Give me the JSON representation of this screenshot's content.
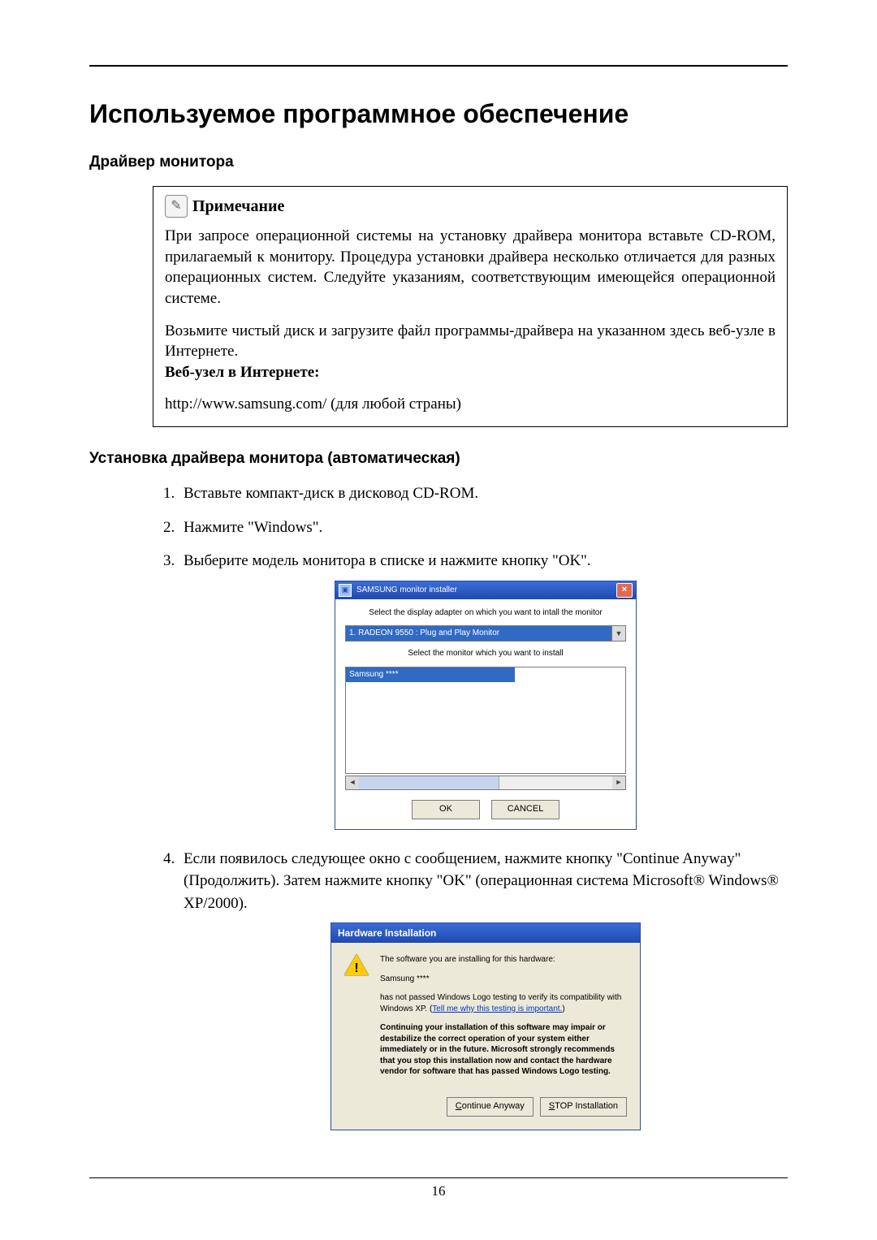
{
  "page_number": "16",
  "h1": "Используемое программное обеспечение",
  "h2_driver": "Драйвер монитора",
  "note": {
    "label": "Примечание",
    "p1": "При запросе операционной системы на установку драйвера монитора вставьте CD-ROM, прилагаемый к монитору. Процедура установки драйвера несколько отличается для разных операционных систем. Следуйте указаниям, соответствующим имеющейся операционной системе.",
    "p2": "Возьмите чистый диск и загрузите файл программы-драйвера на указанном здесь веб-узле в Интернете.",
    "web_label": "Веб-узел в Интернете:",
    "url": "http://www.samsung.com/ (для любой страны)"
  },
  "h2_auto": "Установка драйвера монитора (автоматическая)",
  "steps": {
    "s1": "Вставьте компакт-диск в дисковод CD-ROM.",
    "s2": "Нажмите \"Windows\".",
    "s3": "Выберите модель монитора в списке и нажмите кнопку \"OK\".",
    "s4": "Если появилось следующее окно с сообщением, нажмите кнопку \"Continue Anyway\" (Продолжить). Затем нажмите кнопку \"OK\" (операционная система Microsoft® Windows® XP/2000)."
  },
  "installer": {
    "title": "SAMSUNG monitor installer",
    "instr1": "Select the display adapter on which you want to intall the monitor",
    "adapter": "1. RADEON 9550 : Plug and Play Monitor",
    "instr2": "Select the monitor which you want to install",
    "item": "Samsung ****",
    "ok": "OK",
    "cancel": "CANCEL"
  },
  "hw": {
    "title": "Hardware Installation",
    "line1": "The software you are installing for this hardware:",
    "line2": "Samsung ****",
    "line3a": "has not passed Windows Logo testing to verify its compatibility with Windows XP. (",
    "link": "Tell me why this testing is important.",
    "line3b": ")",
    "bold": "Continuing your installation of this software may impair or destabilize the correct operation of your system either immediately or in the future. Microsoft strongly recommends that you stop this installation now and contact the hardware vendor for software that has passed Windows Logo testing.",
    "btn_continue": "Continue Anyway",
    "btn_stop": "STOP Installation"
  }
}
